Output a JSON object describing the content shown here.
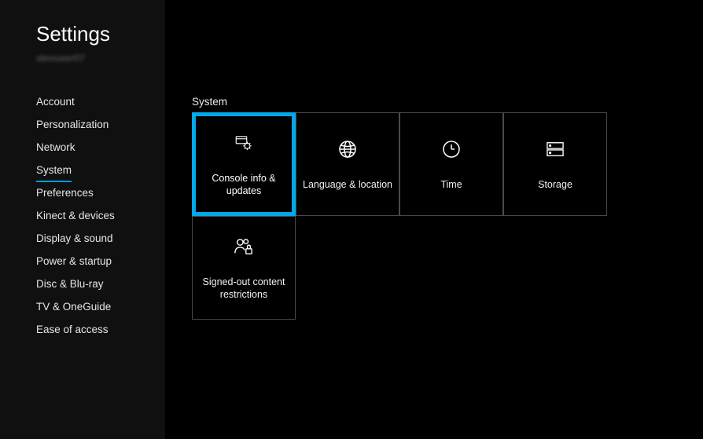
{
  "sidebar": {
    "title": "Settings",
    "subtitle": "xboxuser07",
    "items": [
      {
        "label": "Account",
        "selected": false
      },
      {
        "label": "Personalization",
        "selected": false
      },
      {
        "label": "Network",
        "selected": false
      },
      {
        "label": "System",
        "selected": true
      },
      {
        "label": "Preferences",
        "selected": false
      },
      {
        "label": "Kinect & devices",
        "selected": false
      },
      {
        "label": "Display & sound",
        "selected": false
      },
      {
        "label": "Power & startup",
        "selected": false
      },
      {
        "label": "Disc & Blu-ray",
        "selected": false
      },
      {
        "label": "TV & OneGuide",
        "selected": false
      },
      {
        "label": "Ease of access",
        "selected": false
      }
    ]
  },
  "main": {
    "section_title": "System",
    "tiles": [
      {
        "label": "Console info & updates",
        "icon": "console-gear-icon",
        "selected": true
      },
      {
        "label": "Language & location",
        "icon": "globe-icon",
        "selected": false
      },
      {
        "label": "Time",
        "icon": "clock-icon",
        "selected": false
      },
      {
        "label": "Storage",
        "icon": "storage-icon",
        "selected": false
      },
      {
        "label": "Signed-out content restrictions",
        "icon": "people-lock-icon",
        "selected": false
      }
    ]
  }
}
